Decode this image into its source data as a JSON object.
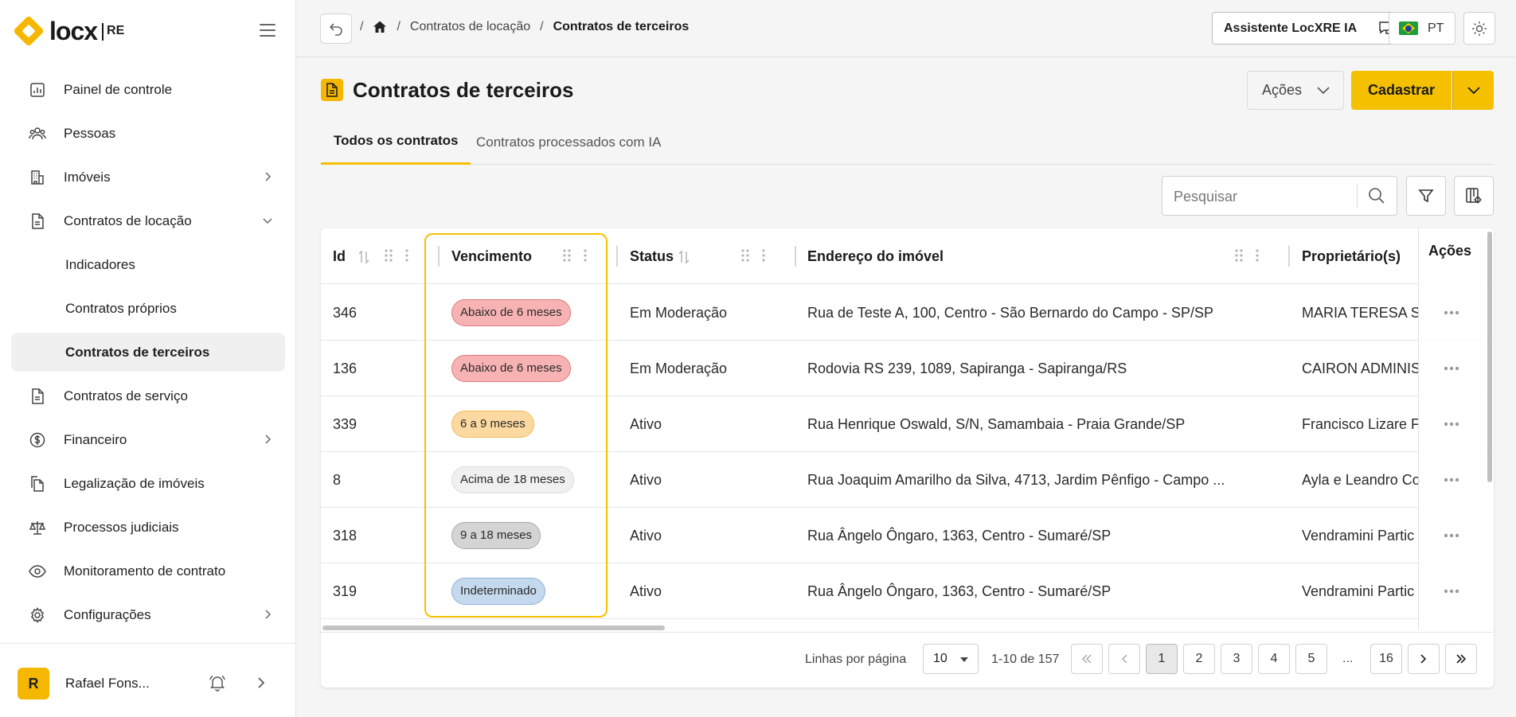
{
  "brand": {
    "logo_text": "locx",
    "logo_sub": "RE"
  },
  "sidebar": {
    "items": [
      {
        "label": "Painel de controle"
      },
      {
        "label": "Pessoas"
      },
      {
        "label": "Imóveis"
      },
      {
        "label": "Contratos de locação"
      },
      {
        "label": "Indicadores"
      },
      {
        "label": "Contratos próprios"
      },
      {
        "label": "Contratos de terceiros"
      },
      {
        "label": "Contratos de serviço"
      },
      {
        "label": "Financeiro"
      },
      {
        "label": "Legalização de imóveis"
      },
      {
        "label": "Processos judiciais"
      },
      {
        "label": "Monitoramento de contrato"
      },
      {
        "label": "Configurações"
      }
    ],
    "user": {
      "initial": "R",
      "name": "Rafael Fons..."
    }
  },
  "topbar": {
    "breadcrumb": {
      "sep": "/",
      "parent": "Contratos de locação",
      "current": "Contratos de terceiros"
    },
    "assistant_label": "Assistente LocXRE IA",
    "lang": "PT"
  },
  "header": {
    "title": "Contratos de terceiros",
    "actions_label": "Ações",
    "create_label": "Cadastrar"
  },
  "tabs": [
    {
      "label": "Todos os contratos"
    },
    {
      "label": "Contratos processados com IA"
    }
  ],
  "search": {
    "placeholder": "Pesquisar"
  },
  "table": {
    "columns": [
      "Id",
      "Vencimento",
      "Status",
      "Endereço do imóvel",
      "Proprietário(s)",
      "Ações"
    ],
    "rows": [
      {
        "id": "346",
        "vencimento": "Abaixo de 6 meses",
        "tone": "red",
        "status": "Em Moderação",
        "endereco": "Rua de Teste A, 100, Centro - São Bernardo do Campo - SP/SP",
        "proprietario": "MARIA TERESA SA"
      },
      {
        "id": "136",
        "vencimento": "Abaixo de 6 meses",
        "tone": "red",
        "status": "Em Moderação",
        "endereco": "Rodovia RS 239, 1089, Sapiranga - Sapiranga/RS",
        "proprietario": "CAIRON ADMINIS"
      },
      {
        "id": "339",
        "vencimento": "6 a 9 meses",
        "tone": "orange",
        "status": "Ativo",
        "endereco": "Rua Henrique Oswald, S/N, Samambaia - Praia Grande/SP",
        "proprietario": "Francisco Lizare F"
      },
      {
        "id": "8",
        "vencimento": "Acima de 18 meses",
        "tone": "light",
        "status": "Ativo",
        "endereco": "Rua Joaquim Amarilho da Silva, 4713, Jardim Pênfigo - Campo ...",
        "proprietario": "Ayla e Leandro Co"
      },
      {
        "id": "318",
        "vencimento": "9 a 18 meses",
        "tone": "gray",
        "status": "Ativo",
        "endereco": "Rua Ângelo Ôngaro, 1363, Centro - Sumaré/SP",
        "proprietario": "Vendramini Partic"
      },
      {
        "id": "319",
        "vencimento": "Indeterminado",
        "tone": "blue",
        "status": "Ativo",
        "endereco": "Rua Ângelo Ôngaro, 1363, Centro - Sumaré/SP",
        "proprietario": "Vendramini Partic"
      }
    ]
  },
  "badge_colors": {
    "red": {
      "bg": "#f7b3b3",
      "border": "#e07a7a"
    },
    "orange": {
      "bg": "#fcd9a0",
      "border": "#f0b95a"
    },
    "light": {
      "bg": "#f0f0f0",
      "border": "#dcdcdc"
    },
    "gray": {
      "bg": "#d4d4d4",
      "border": "#a8a8a8"
    },
    "blue": {
      "bg": "#c5d9ee",
      "border": "#8fb1d6"
    }
  },
  "pagination": {
    "rows_label": "Linhas por página",
    "rows_value": "10",
    "range": "1-10 de 157",
    "pages": [
      "1",
      "2",
      "3",
      "4",
      "5"
    ],
    "ellipsis": "...",
    "last": "16"
  }
}
